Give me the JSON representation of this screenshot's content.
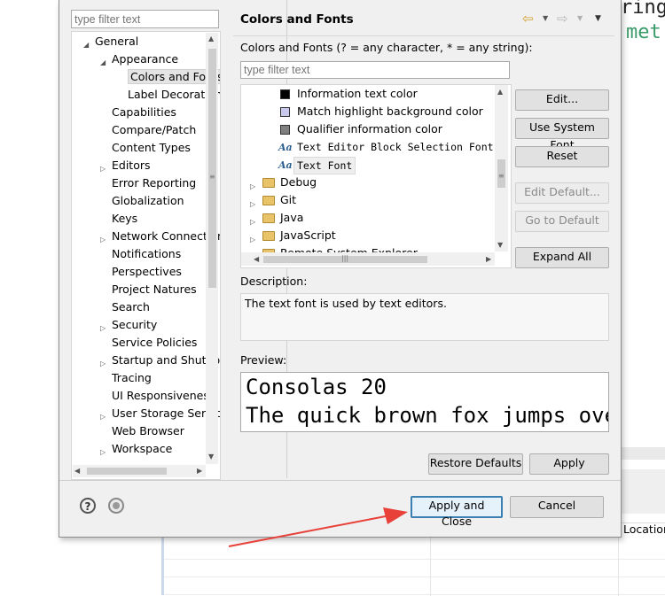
{
  "background": {
    "code_line1": "ring",
    "code_line2": "met",
    "table_header": "Location",
    "arrow_color": "#e8413a"
  },
  "left": {
    "filter_placeholder": "type filter text",
    "tree": [
      {
        "label": "General",
        "level": 0,
        "twisty": "expanded"
      },
      {
        "label": "Appearance",
        "level": 1,
        "twisty": "expanded"
      },
      {
        "label": "Colors and Fonts",
        "level": 2,
        "twisty": "none",
        "selected": true
      },
      {
        "label": "Label Decorations",
        "level": 2,
        "twisty": "none"
      },
      {
        "label": "Capabilities",
        "level": 1,
        "twisty": "none"
      },
      {
        "label": "Compare/Patch",
        "level": 1,
        "twisty": "none"
      },
      {
        "label": "Content Types",
        "level": 1,
        "twisty": "none"
      },
      {
        "label": "Editors",
        "level": 1,
        "twisty": "collapsed"
      },
      {
        "label": "Error Reporting",
        "level": 1,
        "twisty": "none"
      },
      {
        "label": "Globalization",
        "level": 1,
        "twisty": "none"
      },
      {
        "label": "Keys",
        "level": 1,
        "twisty": "none"
      },
      {
        "label": "Network Connections",
        "level": 1,
        "twisty": "collapsed"
      },
      {
        "label": "Notifications",
        "level": 1,
        "twisty": "none"
      },
      {
        "label": "Perspectives",
        "level": 1,
        "twisty": "none"
      },
      {
        "label": "Project Natures",
        "level": 1,
        "twisty": "none"
      },
      {
        "label": "Search",
        "level": 1,
        "twisty": "none"
      },
      {
        "label": "Security",
        "level": 1,
        "twisty": "collapsed"
      },
      {
        "label": "Service Policies",
        "level": 1,
        "twisty": "none"
      },
      {
        "label": "Startup and Shutdown",
        "level": 1,
        "twisty": "collapsed"
      },
      {
        "label": "Tracing",
        "level": 1,
        "twisty": "none"
      },
      {
        "label": "UI Responsiveness",
        "level": 1,
        "twisty": "none"
      },
      {
        "label": "User Storage Service",
        "level": 1,
        "twisty": "collapsed"
      },
      {
        "label": "Web Browser",
        "level": 1,
        "twisty": "none"
      },
      {
        "label": "Workspace",
        "level": 1,
        "twisty": "collapsed"
      }
    ]
  },
  "right": {
    "title": "Colors and Fonts",
    "subtitle": "Colors and Fonts (? = any character, * = any string):",
    "filter_placeholder": "type filter text",
    "list": [
      {
        "label": "Information text color",
        "kind": "swatch",
        "color": "#000000"
      },
      {
        "label": "Match highlight background color",
        "kind": "swatch",
        "color": "#c9c9ee"
      },
      {
        "label": "Qualifier information color",
        "kind": "swatch",
        "color": "#808080"
      },
      {
        "label": "Text Editor Block Selection Font",
        "kind": "font",
        "mono": true
      },
      {
        "label": "Text Font",
        "kind": "font",
        "mono": true,
        "selected": true
      },
      {
        "label": "Debug",
        "kind": "folder"
      },
      {
        "label": "Git",
        "kind": "folder"
      },
      {
        "label": "Java",
        "kind": "folder"
      },
      {
        "label": "JavaScript",
        "kind": "folder"
      },
      {
        "label": "Remote System Explorer",
        "kind": "folder"
      }
    ],
    "buttons": {
      "edit": "Edit...",
      "use_system_font": "Use System Font",
      "reset": "Reset",
      "edit_default": "Edit Default...",
      "go_to_default": "Go to Default",
      "expand_all": "Expand All"
    },
    "description_label": "Description:",
    "description_text": "The text font is used by text editors.",
    "preview_label": "Preview:",
    "preview_line1": "Consolas 20",
    "preview_line2": "The quick brown fox jumps over the lazy dog.",
    "restore_defaults": "Restore Defaults",
    "apply": "Apply"
  },
  "footer": {
    "help_glyph": "?",
    "apply_and_close": "Apply and Close",
    "cancel": "Cancel"
  }
}
